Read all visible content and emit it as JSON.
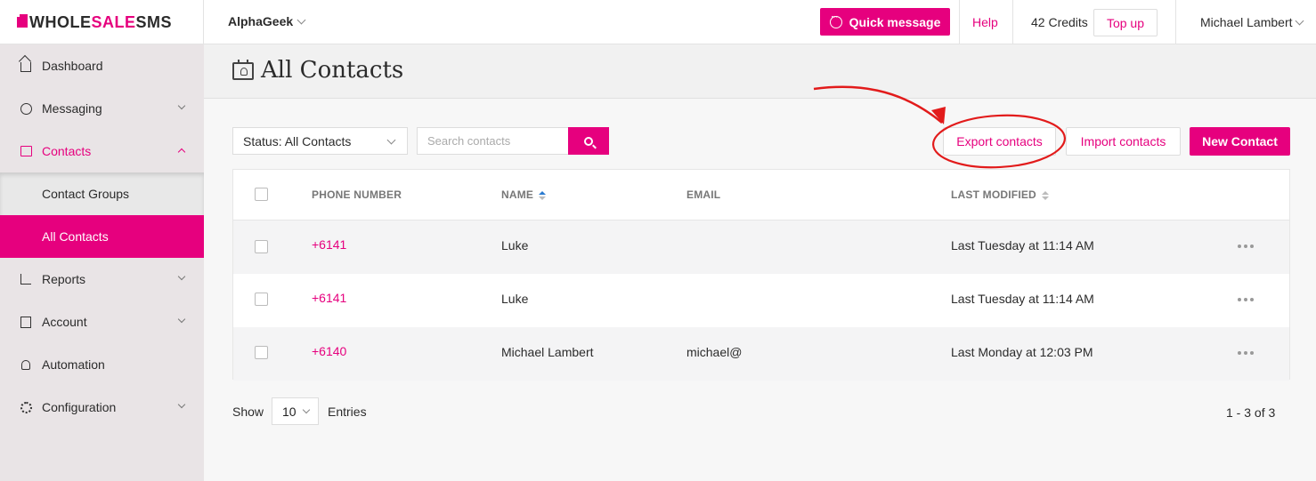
{
  "brand": {
    "logo_part1": "WHOLE",
    "logo_part2": "SALE",
    "logo_part3": "SMS",
    "accent": "#e6007e"
  },
  "header": {
    "account": "AlphaGeek",
    "quick_message": "Quick message",
    "help": "Help",
    "credits": "42 Credits",
    "top_up": "Top up",
    "user": "Michael Lambert"
  },
  "sidebar": {
    "items": [
      {
        "label": "Dashboard",
        "icon": "home-icon"
      },
      {
        "label": "Messaging",
        "icon": "chat-icon"
      },
      {
        "label": "Contacts",
        "icon": "contacts-icon"
      },
      {
        "label": "Contact Groups"
      },
      {
        "label": "All Contacts"
      },
      {
        "label": "Reports",
        "icon": "chart-icon"
      },
      {
        "label": "Account",
        "icon": "document-icon"
      },
      {
        "label": "Automation",
        "icon": "bell-icon"
      },
      {
        "label": "Configuration",
        "icon": "gear-icon"
      }
    ]
  },
  "page": {
    "title": "All Contacts",
    "status_filter": "Status: All Contacts",
    "search_placeholder": "Search contacts",
    "export": "Export contacts",
    "import": "Import contacts",
    "new_contact": "New Contact"
  },
  "table": {
    "columns": [
      "PHONE NUMBER",
      "NAME",
      "EMAIL",
      "LAST MODIFIED"
    ],
    "rows": [
      {
        "phone": "+6141",
        "name": "Luke",
        "email": "",
        "modified": "Last Tuesday at 11:14 AM"
      },
      {
        "phone": "+6141",
        "name": "Luke",
        "email": "",
        "modified": "Last Tuesday at 11:14 AM"
      },
      {
        "phone": "+6140",
        "name": "Michael Lambert",
        "email": "michael@",
        "modified": "Last Monday at 12:03 PM"
      }
    ]
  },
  "footer": {
    "show": "Show",
    "page_size": "10",
    "entries": "Entries",
    "range": "1 - 3 of 3"
  }
}
